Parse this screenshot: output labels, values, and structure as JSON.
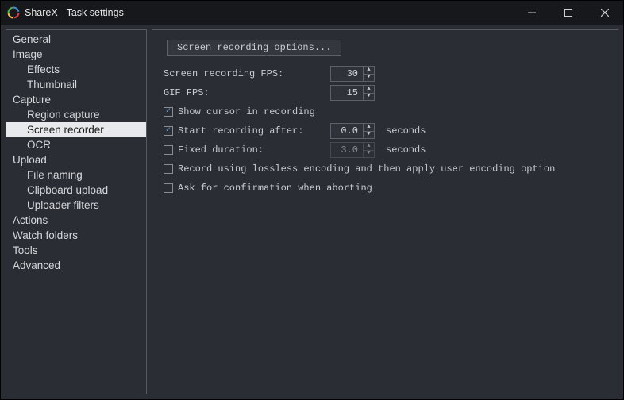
{
  "window": {
    "title": "ShareX - Task settings"
  },
  "sidebar": {
    "items": [
      {
        "label": "General",
        "child": false,
        "selected": false
      },
      {
        "label": "Image",
        "child": false,
        "selected": false
      },
      {
        "label": "Effects",
        "child": true,
        "selected": false
      },
      {
        "label": "Thumbnail",
        "child": true,
        "selected": false
      },
      {
        "label": "Capture",
        "child": false,
        "selected": false
      },
      {
        "label": "Region capture",
        "child": true,
        "selected": false
      },
      {
        "label": "Screen recorder",
        "child": true,
        "selected": true
      },
      {
        "label": "OCR",
        "child": true,
        "selected": false
      },
      {
        "label": "Upload",
        "child": false,
        "selected": false
      },
      {
        "label": "File naming",
        "child": true,
        "selected": false
      },
      {
        "label": "Clipboard upload",
        "child": true,
        "selected": false
      },
      {
        "label": "Uploader filters",
        "child": true,
        "selected": false
      },
      {
        "label": "Actions",
        "child": false,
        "selected": false
      },
      {
        "label": "Watch folders",
        "child": false,
        "selected": false
      },
      {
        "label": "Tools",
        "child": false,
        "selected": false
      },
      {
        "label": "Advanced",
        "child": false,
        "selected": false
      }
    ]
  },
  "main": {
    "options_button": "Screen recording options...",
    "fps_label": "Screen recording FPS:",
    "fps_value": "30",
    "gif_fps_label": "GIF FPS:",
    "gif_fps_value": "15",
    "show_cursor": {
      "checked": true,
      "label": "Show cursor in recording"
    },
    "start_after": {
      "checked": true,
      "label": "Start recording after:",
      "value": "0.0",
      "unit": "seconds"
    },
    "fixed_dur": {
      "checked": false,
      "label": "Fixed duration:",
      "value": "3.0",
      "unit": "seconds"
    },
    "lossless": {
      "checked": false,
      "label": "Record using lossless encoding and then apply user encoding option"
    },
    "confirm_abort": {
      "checked": false,
      "label": "Ask for confirmation when aborting"
    }
  }
}
